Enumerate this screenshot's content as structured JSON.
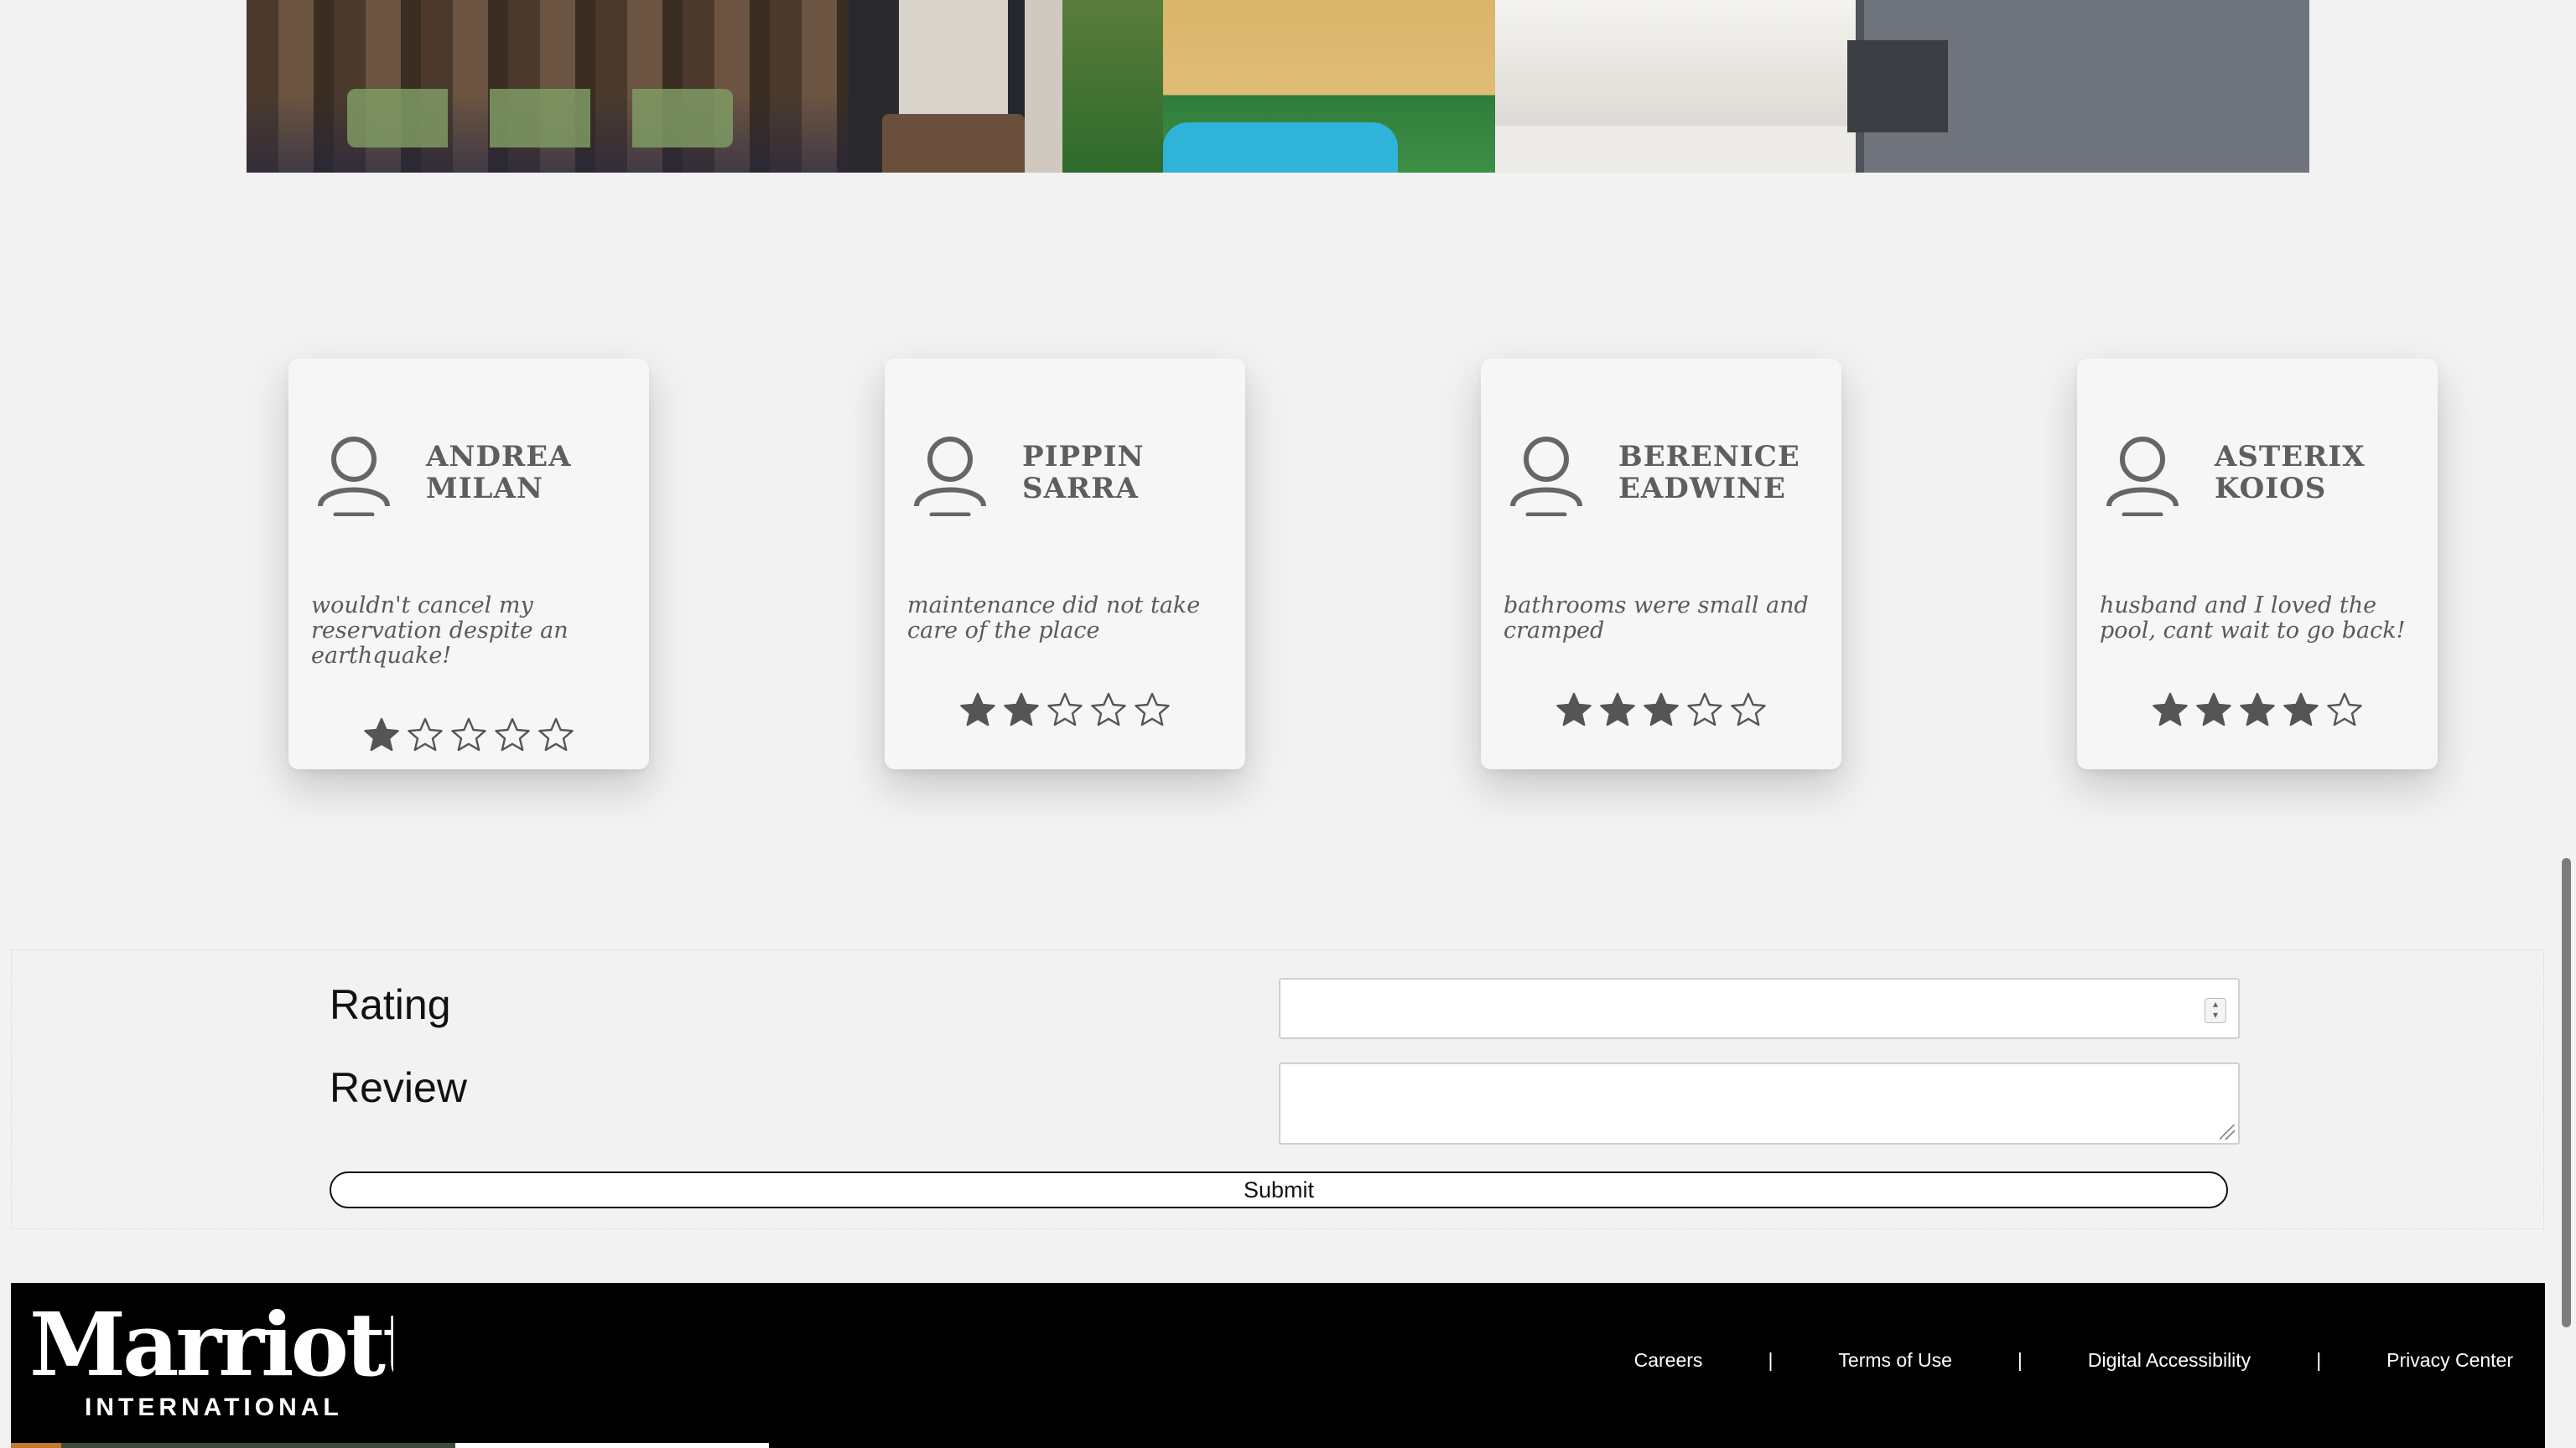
{
  "gallery": {
    "images": [
      {
        "alt": "hotel lobby with green chairs"
      },
      {
        "alt": "lounge seating area"
      },
      {
        "alt": "courtyard with swimming pool"
      },
      {
        "alt": "guest room with bed and desk"
      }
    ]
  },
  "reviews": [
    {
      "first_name": "ANDREA",
      "last_name": "MILAN",
      "text": "wouldn't cancel my reservation despite an earthquake!",
      "rating": 1,
      "max_rating": 5
    },
    {
      "first_name": "PIPPIN",
      "last_name": "SARRA",
      "text": "maintenance did not take care of the place",
      "rating": 2,
      "max_rating": 5
    },
    {
      "first_name": "BERENICE",
      "last_name": "EADWINE",
      "text": "bathrooms were small and cramped",
      "rating": 3,
      "max_rating": 5
    },
    {
      "first_name": "ASTERIX",
      "last_name": "KOIOS",
      "text": "husband and I loved the pool, cant wait to go back!",
      "rating": 4,
      "max_rating": 5
    }
  ],
  "form": {
    "rating_label": "Rating",
    "rating_value": "",
    "review_label": "Review",
    "review_value": "",
    "submit_label": "Submit"
  },
  "footer": {
    "logo_word": "Marriott",
    "logo_sub": "INTERNATIONAL",
    "links": [
      "Careers",
      "Terms of Use",
      "Digital Accessibility",
      "Privacy Center"
    ],
    "separator": "|"
  },
  "colors": {
    "page_background": "#f2f2f2",
    "card_background": "#f6f6f6",
    "star_fill": "#555555",
    "footer_background": "#000000"
  },
  "icons": {
    "avatar": "user-outline-icon",
    "star_filled": "star-filled-icon",
    "star_empty": "star-outline-icon"
  }
}
